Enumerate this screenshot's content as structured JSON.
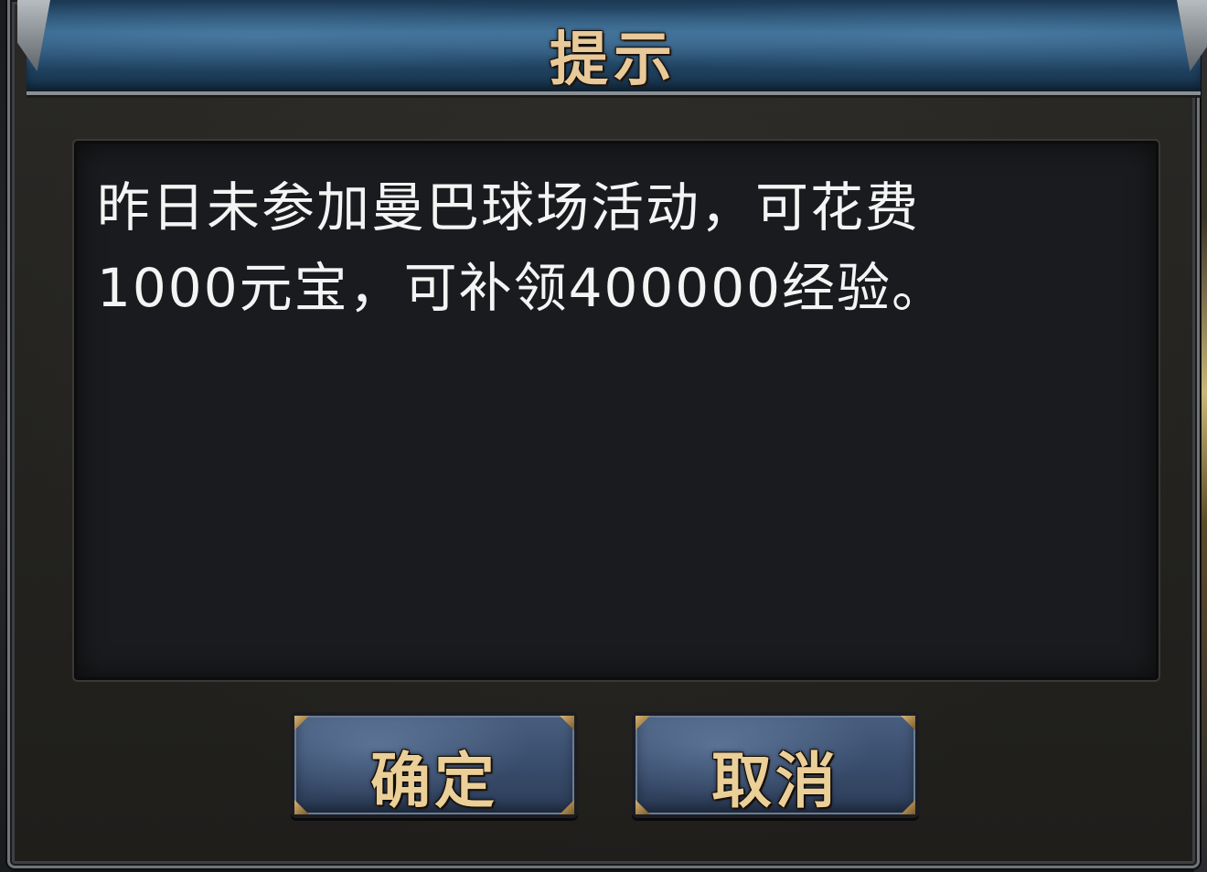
{
  "dialog": {
    "title": "提示",
    "message": "昨日未参加曼巴球场活动，可花费\n1000元宝，可补领400000经验。",
    "confirm_label": "确定",
    "cancel_label": "取消"
  },
  "colors": {
    "title_text": "#e8c99a",
    "title_bar": "#2f5f86",
    "panel_bg": "#1a1b1e",
    "message_text": "#f4f4f4",
    "button_bg": "#3a4e6e",
    "button_text": "#ebcf98"
  }
}
